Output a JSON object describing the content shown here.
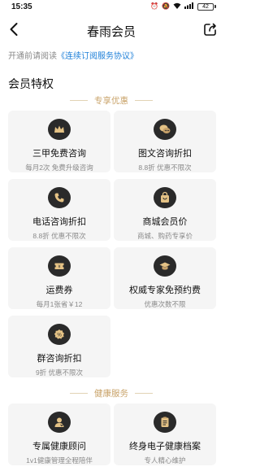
{
  "status_bar": {
    "time": "15:35",
    "battery": "42"
  },
  "nav": {
    "title": "春雨会员"
  },
  "agreement": {
    "prefix": "开通前请阅读",
    "link": "《连续订阅服务协议》"
  },
  "section_title": "会员特权",
  "divider_exclusive": "专享优惠",
  "divider_health": "健康服务",
  "accent_color": "#c9a36a",
  "benefits": [
    {
      "title": "三甲免费咨询",
      "subtitle": "每月2次 免费升级咨询",
      "icon": "crown-icon"
    },
    {
      "title": "图文咨询折扣",
      "subtitle": "8.8折 优惠不限次",
      "icon": "chat-bubbles-icon"
    },
    {
      "title": "电话咨询折扣",
      "subtitle": "8.8折 优惠不限次",
      "icon": "phone-icon"
    },
    {
      "title": "商城会员价",
      "subtitle": "商城、购药专享价",
      "icon": "shopping-bag-icon"
    },
    {
      "title": "运费券",
      "subtitle": "每月1张省￥12",
      "icon": "shipping-coupon-icon"
    },
    {
      "title": "权威专家免预约费",
      "subtitle": "优惠次数不限",
      "icon": "graduation-cap-icon"
    },
    {
      "title": "群咨询折扣",
      "subtitle": "9折 优惠不限次",
      "icon": "discount-tag-icon"
    }
  ],
  "health_services": [
    {
      "title": "专属健康顾问",
      "subtitle": "1v1健康管理全程陪伴",
      "icon": "advisor-icon"
    },
    {
      "title": "终身电子健康档案",
      "subtitle": "专人精心维护",
      "icon": "health-record-icon"
    }
  ]
}
